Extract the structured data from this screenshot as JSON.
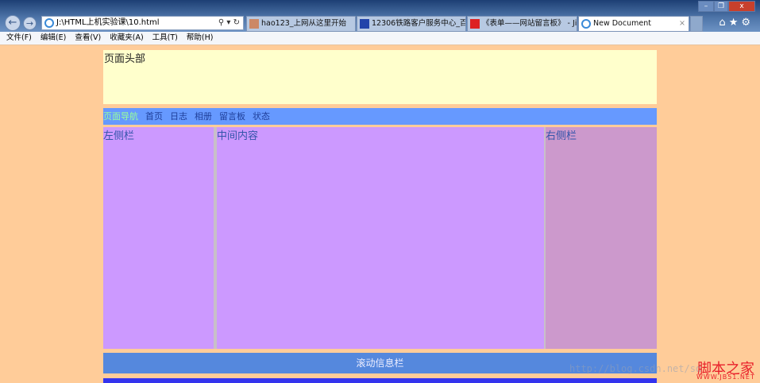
{
  "browser": {
    "address": "J:\\HTML上机实验课\\10.html",
    "tabs": [
      {
        "label": "hao123_上网从这里开始",
        "active": false
      },
      {
        "label": "12306铁路客户服务中心_百度...",
        "active": false
      },
      {
        "label": "《表单——网站留言板》 - Jia...",
        "active": false
      },
      {
        "label": "New Document",
        "active": true
      }
    ],
    "tab_close": "×",
    "menu": [
      "文件(F)",
      "编辑(E)",
      "查看(V)",
      "收藏夹(A)",
      "工具(T)",
      "帮助(H)"
    ]
  },
  "page": {
    "header": "页面头部",
    "nav_title": "页面导航",
    "nav_links": [
      "首页",
      "日志",
      "相册",
      "留言板",
      "状态"
    ],
    "left": "左侧栏",
    "middle": "中间内容",
    "right": "右侧栏",
    "scroll": "滚动信息栏"
  },
  "watermarks": {
    "url": "http://blog.csdn.net/sd",
    "logo": "脚本之家",
    "logo_url": "WWW.JB51.NET"
  },
  "colors": {
    "page_bg": "#FFCC99",
    "header": "#FFFFCC",
    "nav": "#6699FF",
    "sidebar": "#CC99FF",
    "right": "#CC99CC",
    "scroll": "#5588DD",
    "footer": "#3333EE"
  }
}
